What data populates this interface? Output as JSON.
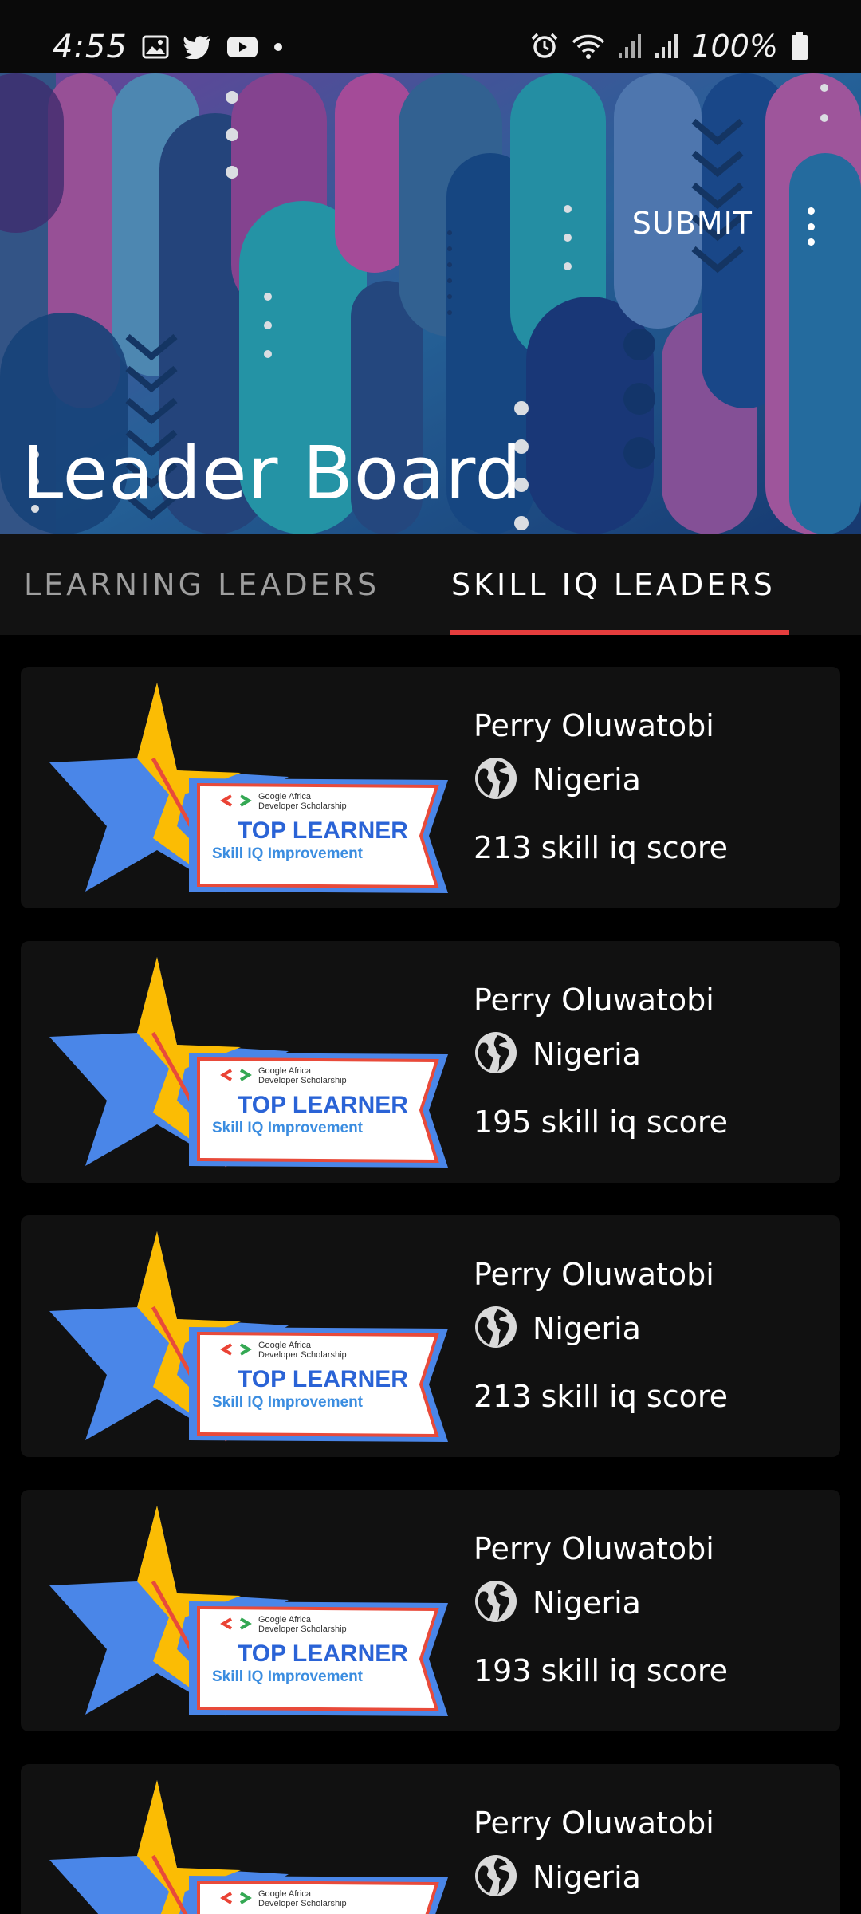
{
  "status_bar": {
    "time": "4:55",
    "battery": "100%",
    "icons": [
      "gallery-icon",
      "twitter-icon",
      "youtube-icon",
      "dot-icon",
      "alarm-icon",
      "wifi-icon",
      "signal-icon",
      "signal-icon",
      "battery-icon"
    ]
  },
  "header": {
    "title": "Leader Board",
    "submit_label": "SUBMIT"
  },
  "tabs": [
    {
      "label": "LEARNING LEADERS",
      "selected": false
    },
    {
      "label": "SKILL IQ LEADERS",
      "selected": true
    }
  ],
  "colors": {
    "accent": "#e53d3d",
    "card": "#111111",
    "background": "#000000",
    "star_blue": "#4a86e8",
    "star_yellow": "#fbbc04"
  },
  "badge": {
    "brand_line1": "Google Africa",
    "brand_line2": "Developer Scholarship",
    "headline": "TOP LEARNER",
    "subline": "Skill IQ Improvement"
  },
  "leaders": [
    {
      "name": "Perry Oluwatobi",
      "country": "Nigeria",
      "score": "213 skill iq score"
    },
    {
      "name": "Perry Oluwatobi",
      "country": "Nigeria",
      "score": "195 skill iq score"
    },
    {
      "name": "Perry Oluwatobi",
      "country": "Nigeria",
      "score": "213 skill iq score"
    },
    {
      "name": "Perry Oluwatobi",
      "country": "Nigeria",
      "score": "193 skill iq score"
    },
    {
      "name": "Perry Oluwatobi",
      "country": "Nigeria",
      "score": ""
    }
  ]
}
